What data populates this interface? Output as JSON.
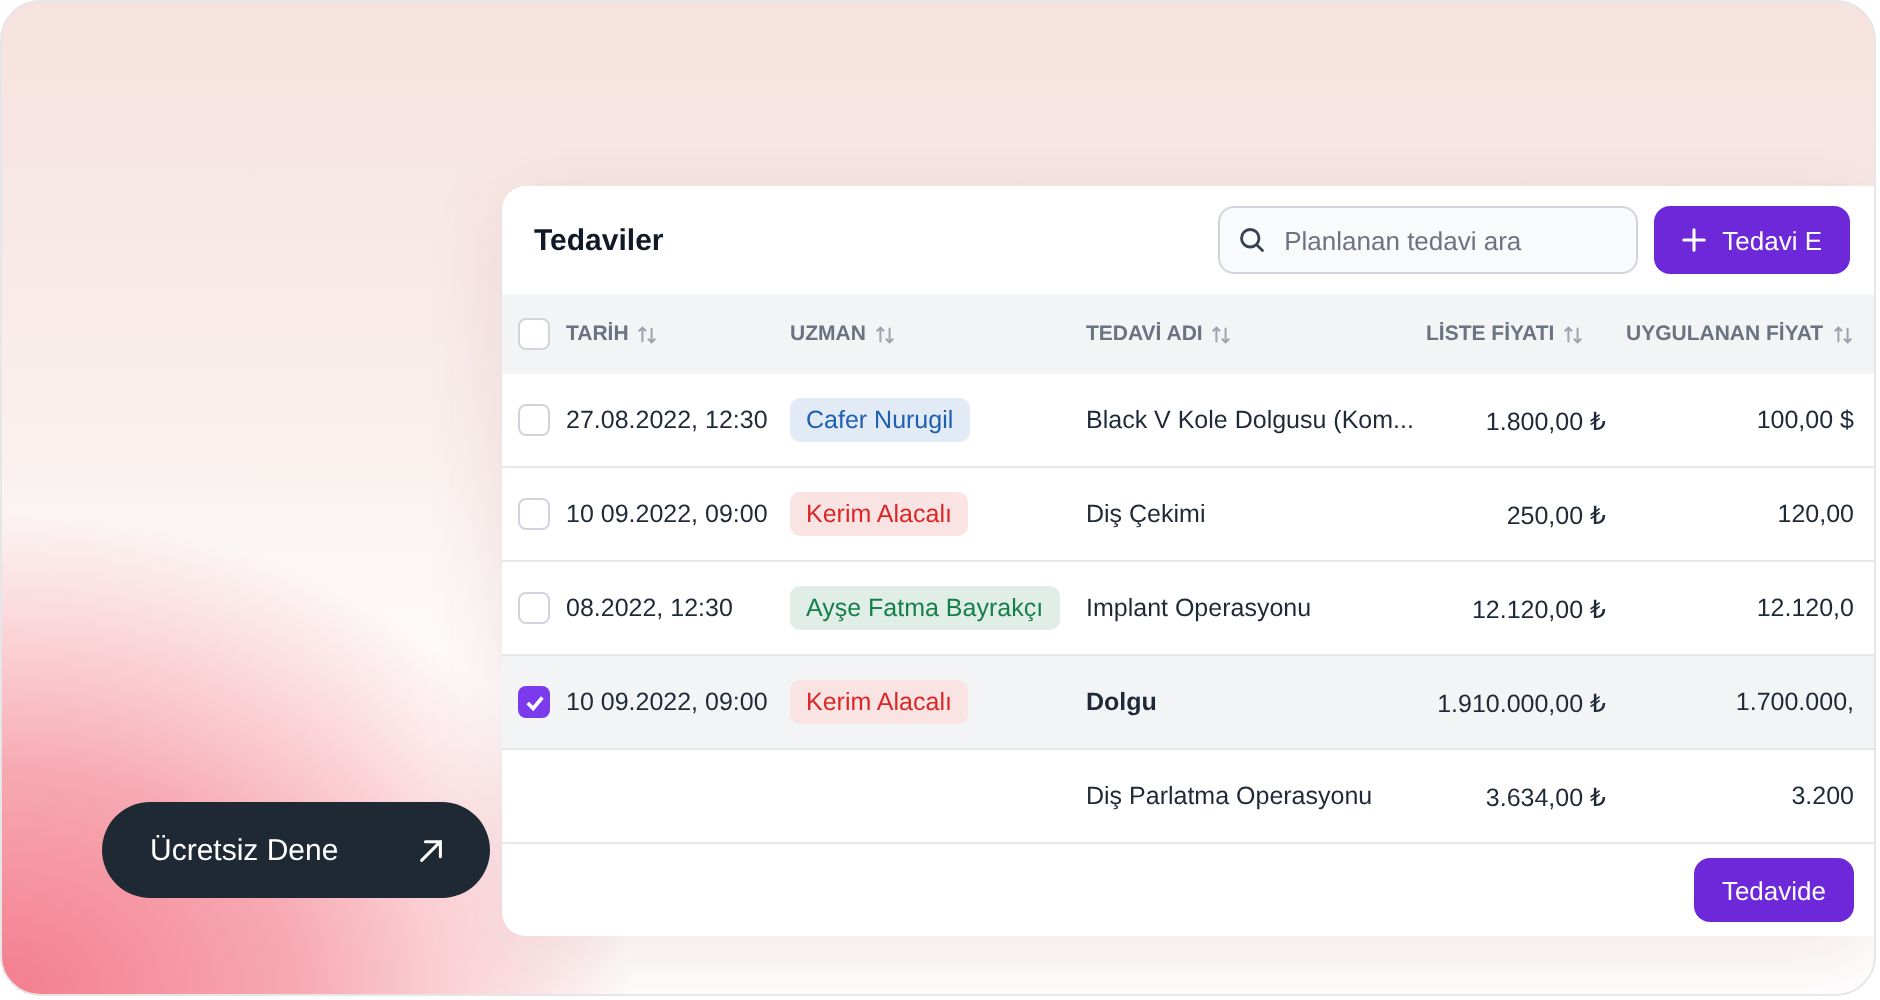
{
  "cta": {
    "label": "Ücretsiz Dene"
  },
  "card": {
    "title": "Tedaviler",
    "search": {
      "placeholder": "Planlanan tedavi ara"
    },
    "add_button": {
      "label": "Tedavi E"
    }
  },
  "table": {
    "select_all": {
      "checked": false
    },
    "columns": [
      {
        "label": "TARİH"
      },
      {
        "label": "UZMAN"
      },
      {
        "label": "TEDAVİ ADI"
      },
      {
        "label": "LİSTE FİYATI"
      },
      {
        "label": "UYGULANAN  FİYAT"
      }
    ],
    "rows": [
      {
        "checked": false,
        "selected": false,
        "date": "27.08.2022, 12:30",
        "specialist": {
          "name": "Cafer Nurugil",
          "color": "#1d5fb0"
        },
        "treatment": "Black V Kole Dolgusu (Kom...",
        "list_price": "1.800,00 ₺",
        "applied_price": "100,00 $"
      },
      {
        "checked": false,
        "selected": false,
        "date": "10 09.2022, 09:00",
        "specialist": {
          "name": "Kerim Alacalı",
          "color": "#dc2626"
        },
        "treatment": "Diş Çekimi",
        "list_price": "250,00 ₺",
        "applied_price": "120,00"
      },
      {
        "checked": false,
        "selected": false,
        "date": "08.2022, 12:30",
        "specialist": {
          "name": "Ayşe Fatma Bayrakçı",
          "color": "#16804a"
        },
        "treatment": "Implant Operasyonu",
        "list_price": "12.120,00 ₺",
        "applied_price": "12.120,0"
      },
      {
        "checked": true,
        "selected": true,
        "date": "10 09.2022, 09:00",
        "specialist": {
          "name": "Kerim Alacalı",
          "color": "#dc2626"
        },
        "treatment": "Dolgu",
        "list_price": "1.910.000,00 ₺",
        "applied_price": "1.700.000,"
      },
      {
        "selected": false,
        "treatment": "Diş Parlatma Operasyonu",
        "list_price": "3.634,00 ₺",
        "applied_price": "3.200"
      }
    ],
    "footer_button": {
      "label": "Tedavide"
    }
  }
}
